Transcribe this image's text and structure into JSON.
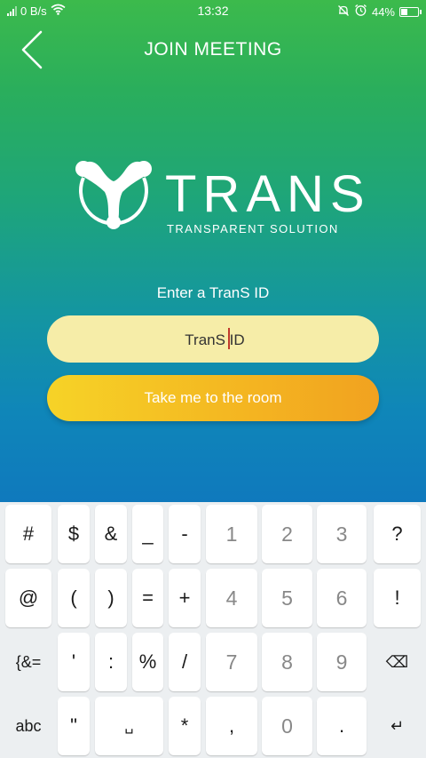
{
  "status_bar": {
    "network_speed": "0 B/s",
    "time": "13:32",
    "battery": "44%",
    "battery_level": 0.44
  },
  "header": {
    "title": "JOIN MEETING"
  },
  "logo": {
    "wordmark": "TRANS",
    "tagline": "TRANSPARENT SOLUTION"
  },
  "form": {
    "prompt": "Enter a TranS ID",
    "id_placeholder": "TranS ID",
    "id_value": "",
    "submit_label": "Take me to the room"
  },
  "keyboard": {
    "rows": [
      [
        "#",
        "$",
        "&",
        "_",
        "-",
        "1",
        "2",
        "3",
        "?"
      ],
      [
        "@",
        "(",
        ")",
        "=",
        "+",
        "4",
        "5",
        "6",
        "!"
      ],
      [
        "{&=",
        "'",
        ":",
        "%",
        "/",
        "7",
        "8",
        "9",
        "backspace"
      ],
      [
        "abc",
        "\"",
        "space",
        "*",
        ",",
        "0",
        ".",
        "enter"
      ]
    ],
    "special_icons": {
      "space": "␣",
      "backspace": "⌫",
      "enter": "↵"
    }
  },
  "colors": {
    "gradient_top": "#3cba4c",
    "gradient_bottom": "#0f79bd",
    "input_bg": "#f6eda8",
    "button_start": "#f6d327",
    "button_end": "#f1a220",
    "keyboard_bg": "#eceff1"
  }
}
